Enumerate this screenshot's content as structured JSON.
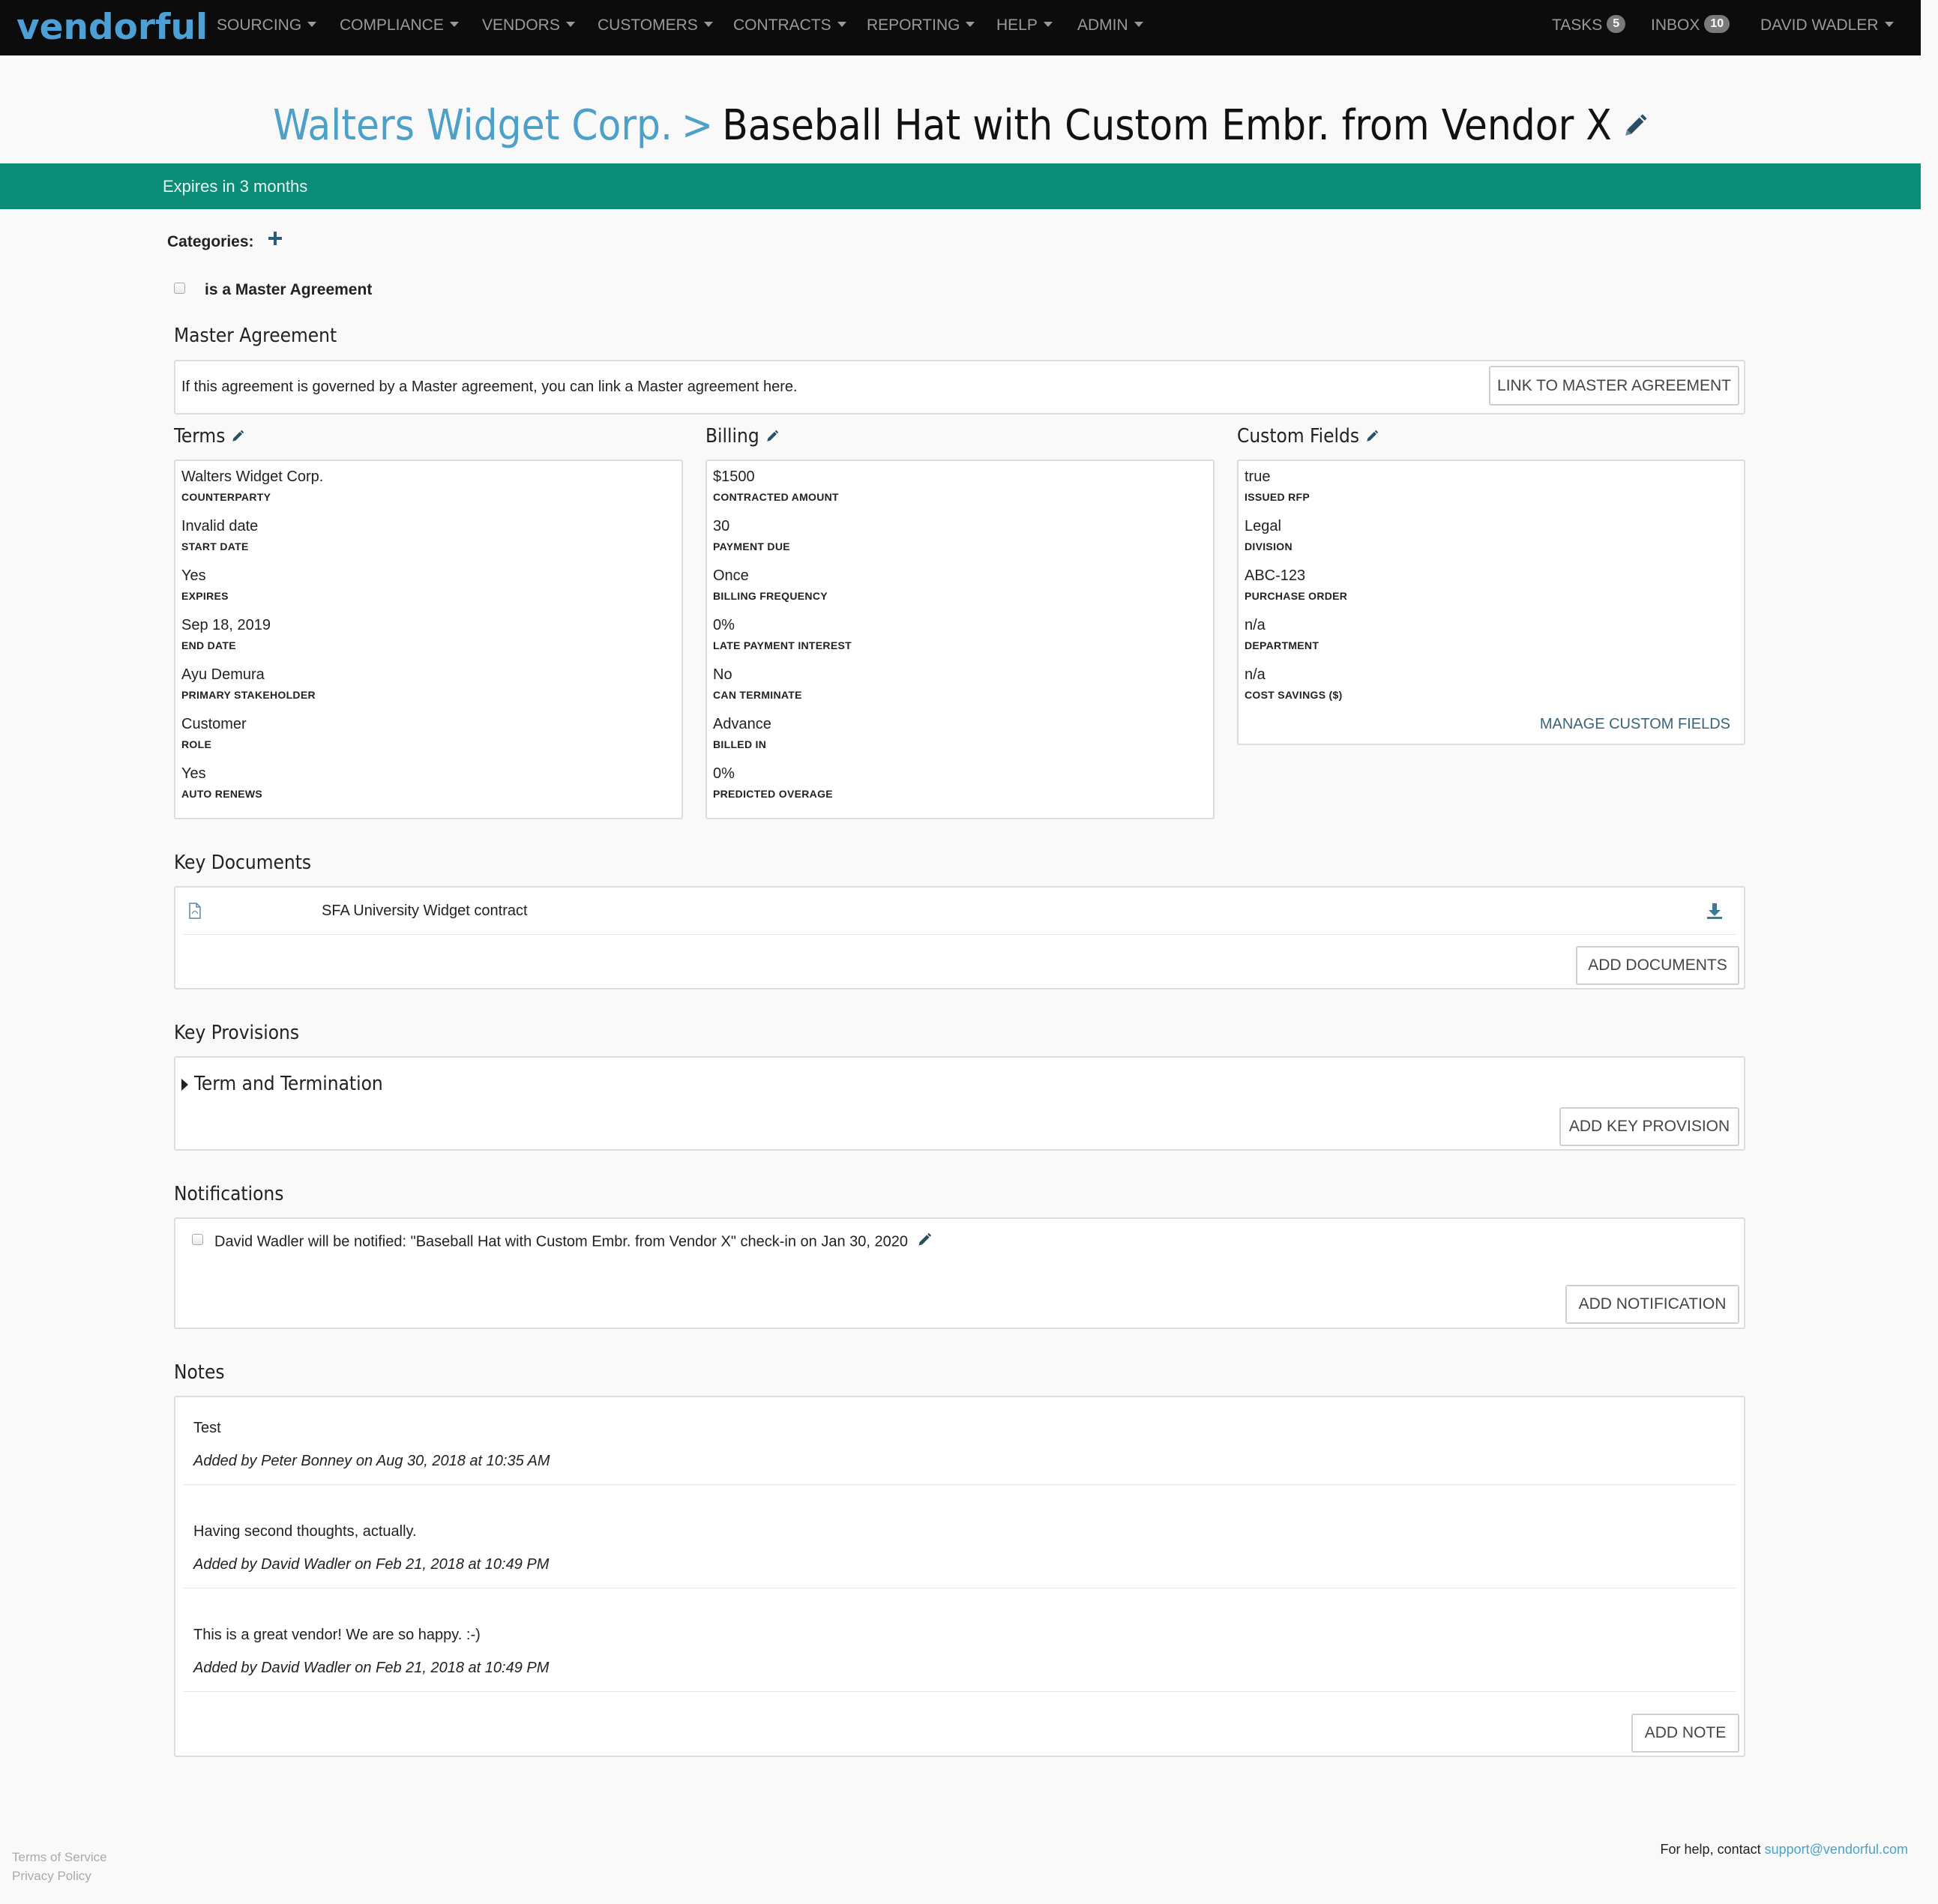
{
  "nav": {
    "logo": "vendorful",
    "menus": [
      "SOURCING",
      "COMPLIANCE",
      "VENDORS",
      "CUSTOMERS",
      "CONTRACTS",
      "REPORTING",
      "HELP",
      "ADMIN"
    ],
    "tasks_label": "TASKS",
    "tasks_count": "5",
    "inbox_label": "INBOX",
    "inbox_count": "10",
    "user": "DAVID WADLER"
  },
  "header": {
    "company": "Walters Widget Corp.",
    "separator": ">",
    "title": "Baseball Hat with Custom Embr. from Vendor X"
  },
  "banner": {
    "text": "Expires in 3 months"
  },
  "categories": {
    "label": "Categories:"
  },
  "master_checkbox": {
    "label": "is a Master Agreement"
  },
  "master_agreement": {
    "title": "Master Agreement",
    "description": "If this agreement is governed by a Master agreement, you can link a Master agreement here.",
    "button": "LINK TO MASTER AGREEMENT"
  },
  "terms": {
    "title": "Terms",
    "fields": [
      {
        "value": "Walters Widget Corp.",
        "label": "COUNTERPARTY"
      },
      {
        "value": "Invalid date",
        "label": "START DATE"
      },
      {
        "value": "Yes",
        "label": "EXPIRES"
      },
      {
        "value": "Sep 18, 2019",
        "label": "END DATE"
      },
      {
        "value": "Ayu Demura",
        "label": "PRIMARY STAKEHOLDER"
      },
      {
        "value": "Customer",
        "label": "ROLE"
      },
      {
        "value": "Yes",
        "label": "AUTO RENEWS"
      }
    ]
  },
  "billing": {
    "title": "Billing",
    "fields": [
      {
        "value": "$1500",
        "label": "CONTRACTED AMOUNT"
      },
      {
        "value": "30",
        "label": "PAYMENT DUE"
      },
      {
        "value": "Once",
        "label": "BILLING FREQUENCY"
      },
      {
        "value": "0%",
        "label": "LATE PAYMENT INTEREST"
      },
      {
        "value": "No",
        "label": "CAN TERMINATE"
      },
      {
        "value": "Advance",
        "label": "BILLED IN"
      },
      {
        "value": "0%",
        "label": "PREDICTED OVERAGE"
      }
    ]
  },
  "custom_fields": {
    "title": "Custom Fields",
    "fields": [
      {
        "value": "true",
        "label": "ISSUED RFP"
      },
      {
        "value": "Legal",
        "label": "DIVISION"
      },
      {
        "value": "ABC-123",
        "label": "PURCHASE ORDER"
      },
      {
        "value": "n/a",
        "label": "DEPARTMENT"
      },
      {
        "value": "n/a",
        "label": "COST SAVINGS ($)"
      }
    ],
    "manage_link": "MANAGE CUSTOM FIELDS"
  },
  "key_documents": {
    "title": "Key Documents",
    "document_name": "SFA University Widget contract",
    "button": "ADD DOCUMENTS"
  },
  "key_provisions": {
    "title": "Key Provisions",
    "provision": "Term and Termination",
    "button": "ADD KEY PROVISION"
  },
  "notifications": {
    "title": "Notifications",
    "item": "David Wadler will be notified: \"Baseball Hat with Custom Embr. from Vendor X\" check-in on Jan 30, 2020",
    "button": "ADD NOTIFICATION"
  },
  "notes": {
    "title": "Notes",
    "items": [
      {
        "text": "Test",
        "meta": "Added by Peter Bonney on Aug 30, 2018 at 10:35 AM"
      },
      {
        "text": "Having second thoughts, actually.",
        "meta": "Added by David Wadler on Feb 21, 2018 at 10:49 PM"
      },
      {
        "text": "This is a great vendor! We are so happy. :-)",
        "meta": "Added by David Wadler on Feb 21, 2018 at 10:49 PM"
      }
    ],
    "button": "ADD NOTE"
  },
  "footer": {
    "terms": "Terms of Service",
    "privacy": "Privacy Policy",
    "help_prefix": "For help, contact",
    "help_email": "support@vendorful.com"
  },
  "colors": {
    "accent": "#4da0c8",
    "banner": "#0b8c77",
    "navbar": "#0c0c0c"
  }
}
